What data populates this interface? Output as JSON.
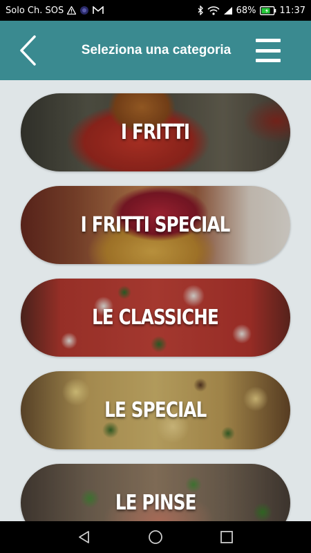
{
  "status_bar": {
    "carrier": "Solo Ch. SOS",
    "battery_percent": "68%",
    "time": "11:37",
    "icons": [
      "warning-icon",
      "vpn-icon",
      "gmail-icon",
      "bluetooth-icon",
      "wifi-icon",
      "signal-icon",
      "battery-icon"
    ]
  },
  "app_bar": {
    "title": "Seleziona una categoria",
    "back_icon": "chevron-left-icon",
    "menu_icon": "hamburger-menu-icon",
    "color": "#3a8a90"
  },
  "categories": [
    {
      "label": "I FRITTI"
    },
    {
      "label": "I FRITTI SPECIAL"
    },
    {
      "label": "LE CLASSICHE"
    },
    {
      "label": "LE SPECIAL"
    },
    {
      "label": "LE PINSE"
    }
  ],
  "nav_bar": {
    "icons": [
      "back-triangle-icon",
      "home-circle-icon",
      "recents-square-icon"
    ]
  }
}
